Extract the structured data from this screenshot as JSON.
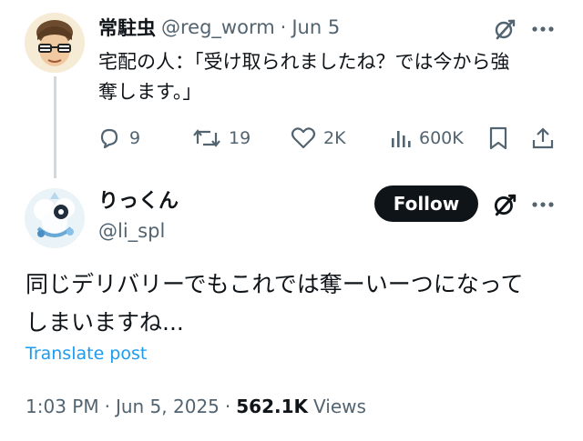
{
  "parent_post": {
    "display_name": "常駐虫",
    "handle": "@reg_worm",
    "separator": "·",
    "date": "Jun 5",
    "text_line1": "宅配の人：「受け取られましたね？では今から強",
    "text_line2": "奪します。」",
    "actions": {
      "replies": "9",
      "reposts": "19",
      "likes": "2K",
      "views": "600K"
    }
  },
  "main_post": {
    "display_name": "りっくん",
    "handle": "@li_spl",
    "follow_label": "Follow",
    "text_line1": "同じデリバリーでもこれでは奪ーいーつになって",
    "text_line2": "しまいますね...",
    "translate_label": "Translate post",
    "time": "1:03 PM",
    "date": "Jun 5, 2025",
    "separator": "·",
    "views_count": "562.1K",
    "views_label": "Views"
  },
  "colors": {
    "text": "#0f1419",
    "muted": "#536471",
    "accent": "#1d9bf0",
    "thread_line": "#cfd9de"
  },
  "icons": [
    "grok-icon",
    "more-icon",
    "reply-icon",
    "repost-icon",
    "like-icon",
    "views-icon",
    "bookmark-icon",
    "share-icon"
  ]
}
